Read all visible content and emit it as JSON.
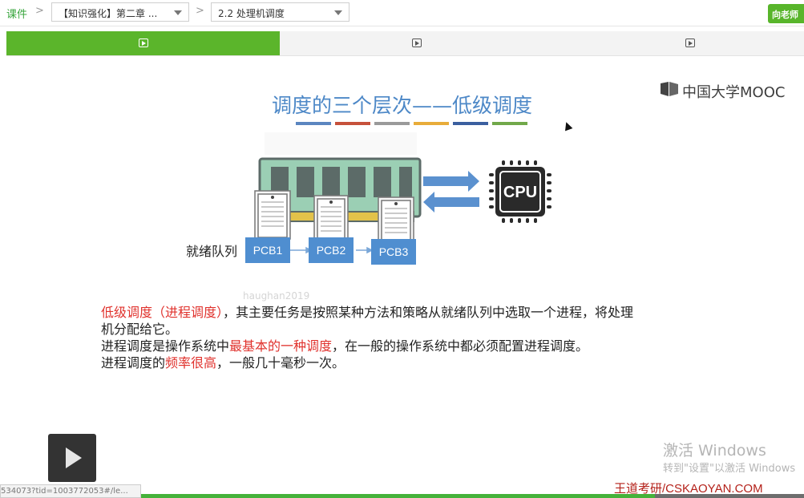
{
  "header": {
    "courseware_link": "课件",
    "chapter_select": "【知识强化】第二章 ...",
    "section_select": "2.2 处理机调度",
    "teacher_button": "向老师"
  },
  "tabs": [
    {
      "icon": "video-icon",
      "active": true
    },
    {
      "icon": "video-icon",
      "active": false
    },
    {
      "icon": "video-icon",
      "active": false
    }
  ],
  "slide": {
    "title": "调度的三个层次——低级调度",
    "color_bars": [
      "#5b86c0",
      "#c6513b",
      "#9a9a9a",
      "#e8ac3a",
      "#3b5f9f",
      "#71a84a"
    ],
    "logo_text": "中国大学MOOC",
    "cpu_label": "CPU",
    "ready_queue_label": "就绪队列",
    "pcbs": [
      "PCB1",
      "PCB2",
      "PCB3"
    ],
    "faint_watermark": "haughan2019",
    "para1_red": "低级调度（进程调度）",
    "para1_rest_line1": "，其主要任务是按照某种方法和策略从就绪队列中选取一个进程，将处理",
    "para1_line2": "机分配给它。",
    "para2_prefix": "进程调度是操作系统中",
    "para2_red": "最基本的一种调度",
    "para2_suffix": "，在一般的操作系统中都必须配置进程调度。",
    "para3_prefix": "进程调度的",
    "para3_red": "频率很高",
    "para3_suffix": "，一般几十毫秒一次。",
    "wangdao": "王道考研/CSKAOYAN.COM"
  },
  "player": {
    "progress": 0.815
  },
  "windows_notice": {
    "line1": "激活 Windows",
    "line2": "转到\"设置\"以激活 Windows"
  },
  "status_url": "534073?tid=1003772053#/le..."
}
